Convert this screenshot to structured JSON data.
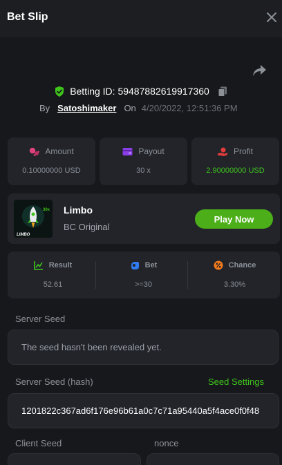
{
  "header": {
    "title": "Bet Slip"
  },
  "bet": {
    "id_label": "Betting ID: 59487882619917360",
    "by_label": "By",
    "user": "Satoshimaker",
    "on_label": "On",
    "date": "4/20/2022, 12:51:36 PM"
  },
  "stats": [
    {
      "label": "Amount",
      "value": "0.10000000 USD"
    },
    {
      "label": "Payout",
      "value": "30 x"
    },
    {
      "label": "Profit",
      "value": "2.90000000 USD"
    }
  ],
  "game": {
    "name": "Limbo",
    "subtitle": "BC Original",
    "play_label": "Play Now",
    "thumb_text": "LIMBO",
    "thumb_multiplier": "30x"
  },
  "metrics": [
    {
      "label": "Result",
      "value": "52.61"
    },
    {
      "label": "Bet",
      "value": ">=30"
    },
    {
      "label": "Chance",
      "value": "3.30%"
    }
  ],
  "seeds": {
    "server_seed_label": "Server Seed",
    "server_seed_value": "The seed hasn't been revealed yet.",
    "server_hash_label": "Server Seed (hash)",
    "seed_settings_label": "Seed Settings",
    "server_hash_value": "1201822c367ad6f176e96b61a0c7c71a95440a5f4ace0f0f48",
    "client_seed_label": "Client Seed",
    "nonce_label": "nonce"
  },
  "colors": {
    "accent_green": "#3fc41c",
    "button_green": "#4caf1a",
    "amount_icon": "#e0437c",
    "payout_icon": "#8a3ee8",
    "profit_icon": "#e23c3c",
    "result_icon": "#3fc41c",
    "bet_icon": "#2f7bf0",
    "chance_icon": "#f07a1c"
  },
  "icons": {
    "close": "close-icon",
    "share": "share-icon",
    "shield": "shield-check-icon",
    "copy": "copy-icon",
    "amount": "coins-icon",
    "payout": "wallet-icon",
    "profit": "hand-coin-icon",
    "result": "chart-icon",
    "bet": "hand-icon",
    "chance": "percent-icon"
  }
}
